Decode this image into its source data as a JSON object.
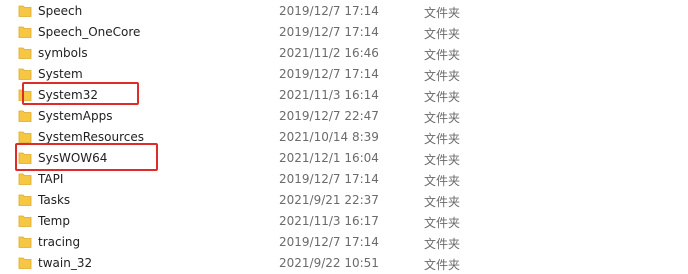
{
  "files": [
    {
      "name": "Speech",
      "date": "2019/12/7 17:14",
      "type": "文件夹",
      "icon": "folder-icon"
    },
    {
      "name": "Speech_OneCore",
      "date": "2019/12/7 17:14",
      "type": "文件夹",
      "icon": "folder-icon"
    },
    {
      "name": "symbols",
      "date": "2021/11/2 16:46",
      "type": "文件夹",
      "icon": "folder-icon"
    },
    {
      "name": "System",
      "date": "2019/12/7 17:14",
      "type": "文件夹",
      "icon": "folder-icon"
    },
    {
      "name": "System32",
      "date": "2021/11/3 16:14",
      "type": "文件夹",
      "icon": "folder-icon"
    },
    {
      "name": "SystemApps",
      "date": "2019/12/7 22:47",
      "type": "文件夹",
      "icon": "folder-icon"
    },
    {
      "name": "SystemResources",
      "date": "2021/10/14 8:39",
      "type": "文件夹",
      "icon": "folder-icon"
    },
    {
      "name": "SysWOW64",
      "date": "2021/12/1 16:04",
      "type": "文件夹",
      "icon": "folder-icon"
    },
    {
      "name": "TAPI",
      "date": "2019/12/7 17:14",
      "type": "文件夹",
      "icon": "folder-icon"
    },
    {
      "name": "Tasks",
      "date": "2021/9/21 22:37",
      "type": "文件夹",
      "icon": "folder-icon"
    },
    {
      "name": "Temp",
      "date": "2021/11/3 16:17",
      "type": "文件夹",
      "icon": "folder-icon"
    },
    {
      "name": "tracing",
      "date": "2019/12/7 17:14",
      "type": "文件夹",
      "icon": "folder-icon"
    },
    {
      "name": "twain_32",
      "date": "2021/9/22 10:51",
      "type": "文件夹",
      "icon": "folder-icon"
    }
  ],
  "highlighted": [
    "System32",
    "SysWOW64"
  ],
  "colors": {
    "highlight": "#e02b2b",
    "folder": "#f5c742",
    "folder_dark": "#e0a92a"
  }
}
